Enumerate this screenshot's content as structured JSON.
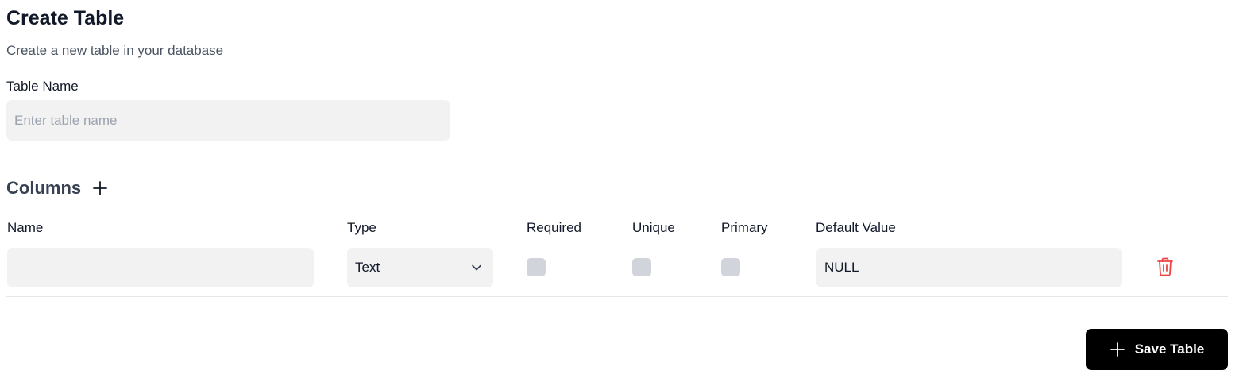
{
  "header": {
    "title": "Create Table",
    "subtitle": "Create a new table in your database"
  },
  "table_name": {
    "label": "Table Name",
    "value": "",
    "placeholder": "Enter table name"
  },
  "columns_section": {
    "title": "Columns",
    "add_icon": "plus-icon"
  },
  "column_headers": {
    "name": "Name",
    "type": "Type",
    "required": "Required",
    "unique": "Unique",
    "primary": "Primary",
    "default_value": "Default Value"
  },
  "rows": [
    {
      "name": "",
      "type": "Text",
      "required": false,
      "unique": false,
      "primary": false,
      "default_value": "NULL",
      "delete_icon": "trash-icon"
    }
  ],
  "footer": {
    "save_label": "Save Table",
    "save_icon": "plus-icon"
  },
  "colors": {
    "delete_icon": "#ef4444",
    "primary_button_bg": "#000000",
    "input_bg": "#f2f2f2",
    "checkbox_bg": "#d1d5db"
  }
}
